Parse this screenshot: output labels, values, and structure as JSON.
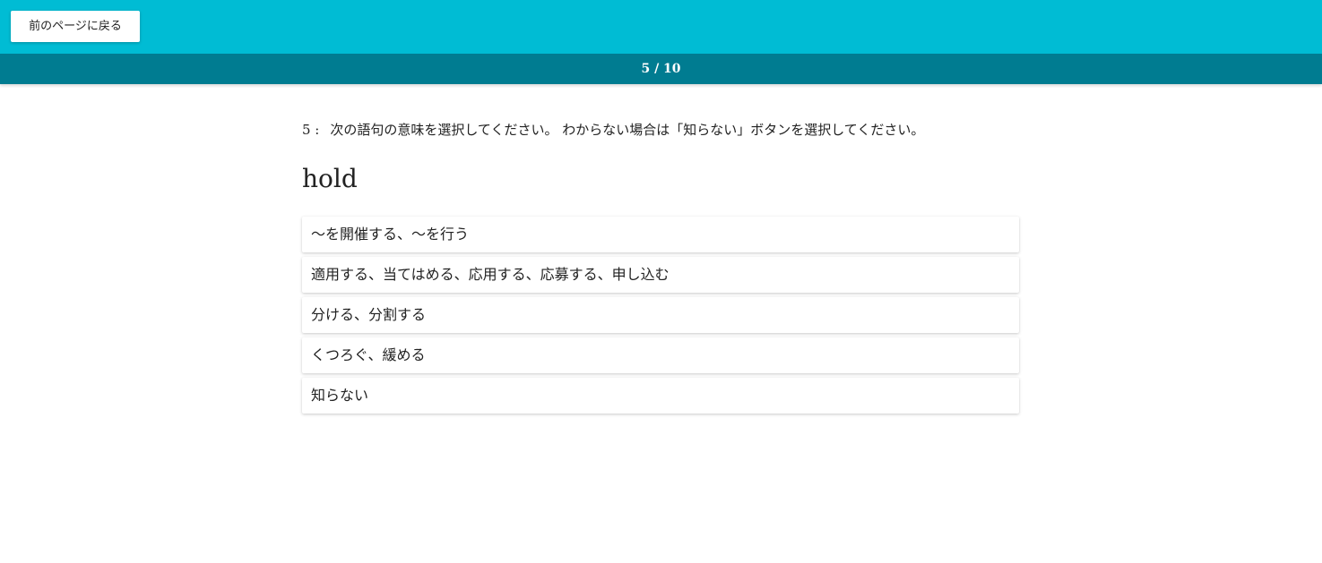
{
  "header": {
    "back_label": "前のページに戻る"
  },
  "progress": {
    "label": "5 / 10",
    "current": 5,
    "total": 10
  },
  "question": {
    "number": "5 :",
    "prompt": "次の語句の意味を選択してください。 わからない場合は「知らない」ボタンを選択してください。",
    "word": "hold"
  },
  "options": [
    {
      "label": "〜を開催する、〜を行う"
    },
    {
      "label": "適用する、当てはめる、応用する、応募する、申し込む"
    },
    {
      "label": "分ける、分割する"
    },
    {
      "label": "くつろぐ、緩める"
    },
    {
      "label": "知らない"
    }
  ],
  "colors": {
    "header_bg": "#00bcd4",
    "progress_bg": "#007c91"
  }
}
